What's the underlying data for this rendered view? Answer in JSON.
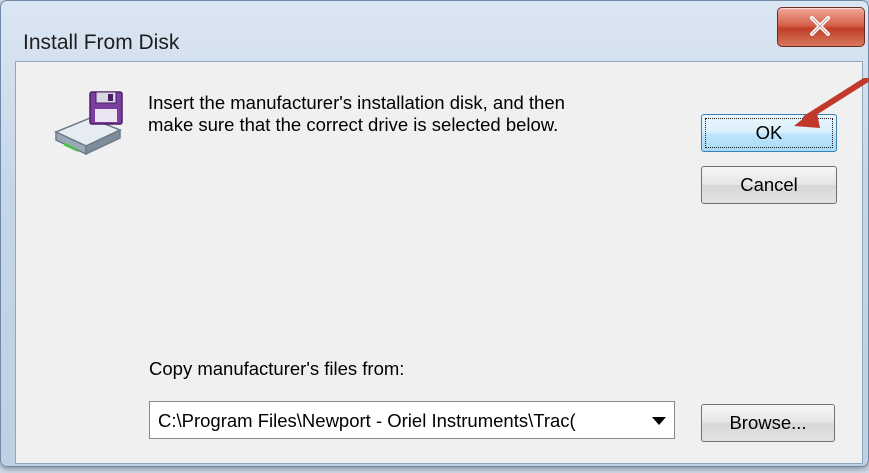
{
  "window": {
    "title": "Install From Disk",
    "close_glyph": "X"
  },
  "dialog": {
    "message_line1": "Insert the manufacturer's installation disk, and then",
    "message_line2": "make sure that the correct drive is selected below.",
    "ok_label": "OK",
    "cancel_label": "Cancel",
    "copy_label": "Copy manufacturer's files from:",
    "path_value": "C:\\Program Files\\Newport - Oriel Instruments\\Trac(",
    "browse_label": "Browse...",
    "icon": "install-disk-icon"
  },
  "annotation": {
    "icon": "red-arrow-icon",
    "color": "#c0392b"
  }
}
